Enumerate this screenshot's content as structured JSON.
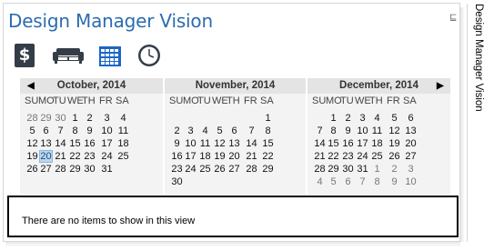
{
  "app": {
    "title": "Design Manager Vision",
    "side_title": "Design Manager Vision",
    "pin_glyph": "⊑"
  },
  "toolbar": {
    "icons": [
      {
        "name": "dollar-icon",
        "glyph": "$"
      },
      {
        "name": "sofa-icon"
      },
      {
        "name": "calendar-grid-icon"
      },
      {
        "name": "clock-icon"
      }
    ]
  },
  "calendars": [
    {
      "title": "October, 2014",
      "weekdays": [
        "SU",
        "MO",
        "TU",
        "WE",
        "TH",
        "FR",
        "SA"
      ],
      "weeks": [
        [
          "28",
          "29",
          "30",
          "1",
          "2",
          "3",
          "4"
        ],
        [
          "5",
          "6",
          "7",
          "8",
          "9",
          "10",
          "11"
        ],
        [
          "12",
          "13",
          "14",
          "15",
          "16",
          "17",
          "18"
        ],
        [
          "19",
          "20",
          "21",
          "22",
          "23",
          "24",
          "25"
        ],
        [
          "26",
          "27",
          "28",
          "29",
          "30",
          "31",
          ""
        ],
        [
          "",
          "",
          "",
          "",
          "",
          "",
          ""
        ]
      ],
      "other_month": [
        [
          0,
          0
        ],
        [
          0,
          1
        ],
        [
          0,
          2
        ]
      ],
      "today": [
        3,
        1
      ]
    },
    {
      "title": "November, 2014",
      "weekdays": [
        "SU",
        "MO",
        "TU",
        "WE",
        "TH",
        "FR",
        "SA"
      ],
      "weeks": [
        [
          "",
          "",
          "",
          "",
          "",
          "",
          "1"
        ],
        [
          "2",
          "3",
          "4",
          "5",
          "6",
          "7",
          "8"
        ],
        [
          "9",
          "10",
          "11",
          "12",
          "13",
          "14",
          "15"
        ],
        [
          "16",
          "17",
          "18",
          "19",
          "20",
          "21",
          "22"
        ],
        [
          "23",
          "24",
          "25",
          "26",
          "27",
          "28",
          "29"
        ],
        [
          "30",
          "",
          "",
          "",
          "",
          "",
          ""
        ]
      ],
      "other_month": [],
      "today": null
    },
    {
      "title": "December, 2014",
      "weekdays": [
        "SU",
        "MO",
        "TU",
        "WE",
        "TH",
        "FR",
        "SA"
      ],
      "weeks": [
        [
          "",
          "1",
          "2",
          "3",
          "4",
          "5",
          "6"
        ],
        [
          "7",
          "8",
          "9",
          "10",
          "11",
          "12",
          "13"
        ],
        [
          "14",
          "15",
          "16",
          "17",
          "18",
          "19",
          "20"
        ],
        [
          "21",
          "22",
          "23",
          "24",
          "25",
          "26",
          "27"
        ],
        [
          "28",
          "29",
          "30",
          "31",
          "1",
          "2",
          "3"
        ],
        [
          "4",
          "5",
          "6",
          "7",
          "8",
          "9",
          "10"
        ]
      ],
      "other_month": [
        [
          4,
          4
        ],
        [
          4,
          5
        ],
        [
          4,
          6
        ],
        [
          5,
          0
        ],
        [
          5,
          1
        ],
        [
          5,
          2
        ],
        [
          5,
          3
        ],
        [
          5,
          4
        ],
        [
          5,
          5
        ],
        [
          5,
          6
        ]
      ],
      "today": null
    }
  ],
  "nav": {
    "prev": "◀",
    "next": "▶"
  },
  "view": {
    "empty_message": "There are no items to show in this view"
  },
  "colors": {
    "title": "#2b6cb0",
    "today_bg": "#bcd6ee",
    "grid_icon": "#1a66c7",
    "dollar_icon": "#343d47"
  }
}
